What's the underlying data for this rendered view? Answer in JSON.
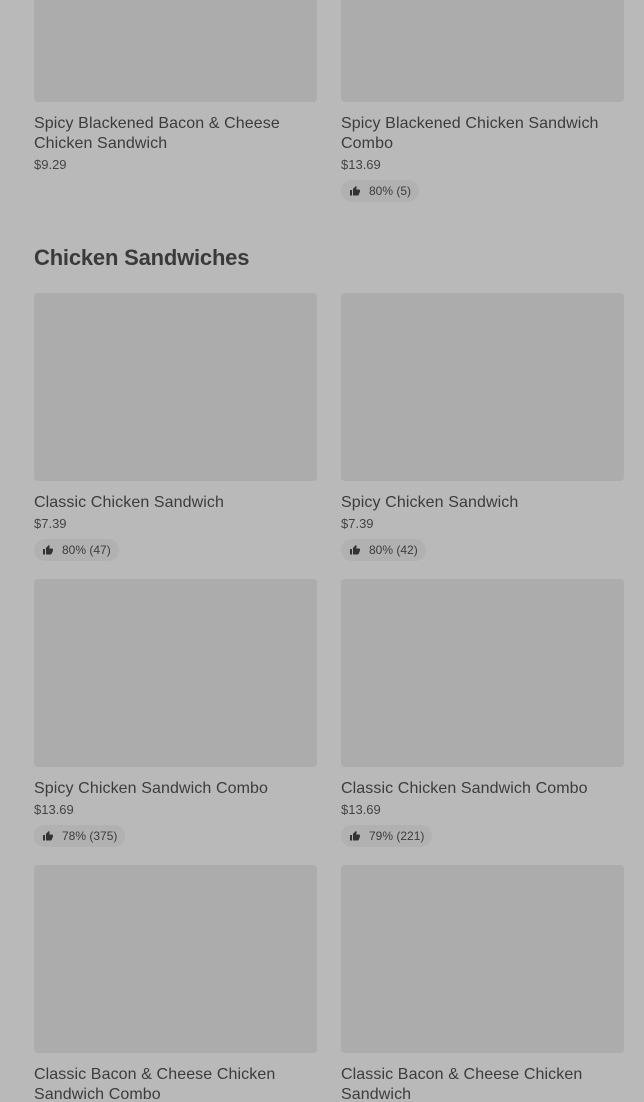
{
  "top_items": [
    {
      "name": "Spicy Blackened Bacon & Cheese Chicken Sandwich",
      "price": "$9.29",
      "rating": ""
    },
    {
      "name": "Spicy Blackened Chicken Sandwich Combo",
      "price": "$13.69",
      "rating": "80% (5)"
    }
  ],
  "section": {
    "title": "Chicken Sandwiches",
    "items": [
      {
        "name": "Classic Chicken Sandwich",
        "price": "$7.39",
        "rating": "80% (47)"
      },
      {
        "name": "Spicy Chicken Sandwich",
        "price": "$7.39",
        "rating": "80% (42)"
      },
      {
        "name": "Spicy Chicken Sandwich Combo",
        "price": "$13.69",
        "rating": "78% (375)"
      },
      {
        "name": "Classic Chicken Sandwich Combo",
        "price": "$13.69",
        "rating": "79% (221)"
      },
      {
        "name": "Classic Bacon & Cheese Chicken Sandwich Combo",
        "price": "",
        "rating": ""
      },
      {
        "name": "Classic Bacon & Cheese Chicken Sandwich",
        "price": "",
        "rating": ""
      }
    ]
  },
  "icons": {
    "rating": "thumbs-up-icon"
  }
}
